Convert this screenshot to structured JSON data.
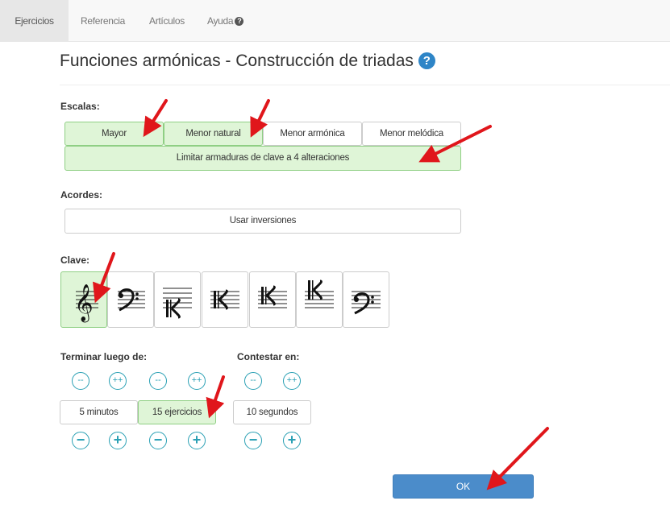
{
  "nav": {
    "tabs": [
      {
        "label": "Ejercicios",
        "active": true
      },
      {
        "label": "Referencia",
        "active": false
      },
      {
        "label": "Artículos",
        "active": false
      },
      {
        "label": "Ayuda",
        "active": false
      }
    ],
    "help_glyph": "?"
  },
  "page": {
    "title": "Funciones armónicas - Construcción de triadas",
    "title_help_glyph": "?"
  },
  "scales": {
    "label": "Escalas:",
    "options": [
      {
        "label": "Mayor",
        "selected": true
      },
      {
        "label": "Menor natural",
        "selected": true
      },
      {
        "label": "Menor armónica",
        "selected": false
      },
      {
        "label": "Menor melódica",
        "selected": false
      }
    ],
    "limit_label": "Limitar armaduras de clave a 4 alteraciones",
    "limit_selected": true
  },
  "chords": {
    "label": "Acordes:",
    "inversions_label": "Usar inversiones",
    "inversions_selected": false
  },
  "clef": {
    "label": "Clave:",
    "options": [
      {
        "icon": "treble-clef-icon",
        "selected": true
      },
      {
        "icon": "bass-clef-icon",
        "selected": false
      },
      {
        "icon": "c-clef-low-icon",
        "selected": false
      },
      {
        "icon": "alto-clef-icon",
        "selected": false
      },
      {
        "icon": "tenor-clef-icon",
        "selected": false
      },
      {
        "icon": "c-clef-high-icon",
        "selected": false
      },
      {
        "icon": "baritone-f-clef-icon",
        "selected": false
      }
    ]
  },
  "finish": {
    "label": "Terminar luego de:",
    "minutes_label": "5 minutos",
    "minutes_selected": false,
    "exercises_label": "15 ejercicios",
    "exercises_selected": true,
    "big_dec": "--",
    "big_inc": "++",
    "dec": "−",
    "inc": "+"
  },
  "answer": {
    "label": "Contestar en:",
    "seconds_label": "10 segundos"
  },
  "ok_label": "OK",
  "colors": {
    "selected_bg": "#dff5d7",
    "selected_border": "#8fcf84",
    "accent": "#4b8cca",
    "stepper": "#2aa0b4",
    "arrow": "#e0161b"
  }
}
